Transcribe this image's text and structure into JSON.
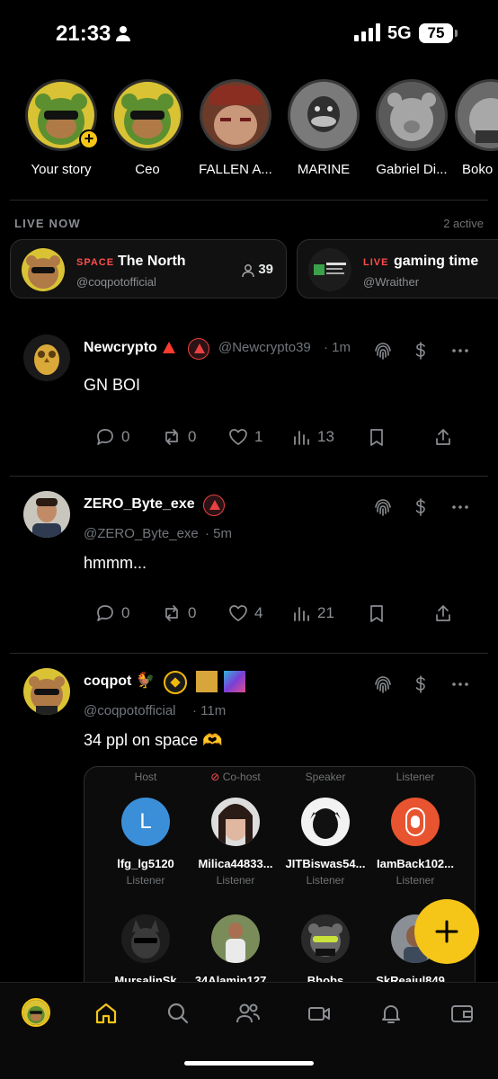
{
  "status_bar": {
    "time": "21:33",
    "network": "5G",
    "battery": "75"
  },
  "stories": [
    {
      "name": "Your story",
      "art": "bear"
    },
    {
      "name": "Ceo",
      "art": "bear"
    },
    {
      "name": "FALLEN A...",
      "art": "face"
    },
    {
      "name": "MARINE",
      "art": "duck"
    },
    {
      "name": "Gabriel Di...",
      "art": "teddy"
    },
    {
      "name": "Boko",
      "art": "teddy"
    }
  ],
  "live": {
    "header": "LIVE NOW",
    "count": "2 active",
    "cards": [
      {
        "tag": "SPACE",
        "title": "The North",
        "handle": "@coqpotofficial",
        "listeners": "39"
      },
      {
        "tag": "LIVE",
        "title": "gaming time",
        "handle": "@Wraither"
      }
    ]
  },
  "posts": [
    {
      "name": "Newcrypto",
      "handle": "@Newcrypto39",
      "time": "· 1m",
      "text": "GN BOI",
      "replies": "0",
      "reposts": "0",
      "likes": "1",
      "views": "13"
    },
    {
      "name": "ZERO_Byte_exe",
      "handle": "@ZERO_Byte_exe",
      "time": "· 5m",
      "text": "hmmm...",
      "replies": "0",
      "reposts": "0",
      "likes": "4",
      "views": "21"
    },
    {
      "name": "coqpot",
      "handle": "@coqpotofficial",
      "time": "· 11m",
      "text": "34 ppl on space"
    }
  ],
  "space_participants": [
    {
      "role": "Host",
      "name": "lfg_lg5120",
      "sub": "Listener"
    },
    {
      "role": "Co-host",
      "name": "Milica44833...",
      "sub": "Listener"
    },
    {
      "role": "Speaker",
      "name": "JITBiswas54...",
      "sub": "Listener"
    },
    {
      "role": "Listener",
      "name": "IamBack102...",
      "sub": "Listener"
    },
    {
      "role": "",
      "name": "MursalinSk",
      "sub": ""
    },
    {
      "role": "",
      "name": "34Alamin127...",
      "sub": ""
    },
    {
      "role": "",
      "name": "Bhobs",
      "sub": ""
    },
    {
      "role": "",
      "name": "SkReajul849...",
      "sub": ""
    }
  ],
  "space_avatar_letter": "L",
  "colors": {
    "accent": "#f5c518",
    "live_red": "#ff4d4d",
    "muted": "#71767b"
  },
  "nav": [
    "profile-avatar",
    "home-icon",
    "search-icon",
    "people-icon",
    "video-icon",
    "bell-icon",
    "wallet-icon"
  ]
}
